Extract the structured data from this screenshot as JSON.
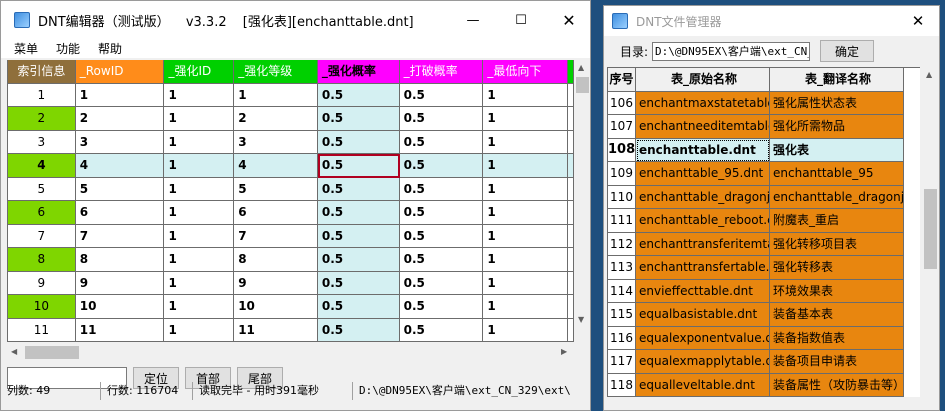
{
  "editor": {
    "app_name": "DNT编辑器（测试版）",
    "version": "v3.3.2",
    "file": "[强化表][enchanttable.dnt]",
    "menu": [
      "菜单",
      "功能",
      "帮助"
    ],
    "columns": [
      "索引信息",
      "_RowID",
      "_强化ID",
      "_强化等级",
      "_强化概率",
      "_打破概率",
      "_最低向下"
    ],
    "rows": [
      [
        "1",
        "1",
        "1",
        "1",
        "0.5",
        "0.5",
        "1"
      ],
      [
        "2",
        "2",
        "1",
        "2",
        "0.5",
        "0.5",
        "1"
      ],
      [
        "3",
        "3",
        "1",
        "3",
        "0.5",
        "0.5",
        "1"
      ],
      [
        "4",
        "4",
        "1",
        "4",
        "0.5",
        "0.5",
        "1"
      ],
      [
        "5",
        "5",
        "1",
        "5",
        "0.5",
        "0.5",
        "1"
      ],
      [
        "6",
        "6",
        "1",
        "6",
        "0.5",
        "0.5",
        "1"
      ],
      [
        "7",
        "7",
        "1",
        "7",
        "0.5",
        "0.5",
        "1"
      ],
      [
        "8",
        "8",
        "1",
        "8",
        "0.5",
        "0.5",
        "1"
      ],
      [
        "9",
        "9",
        "1",
        "9",
        "0.5",
        "0.5",
        "1"
      ],
      [
        "10",
        "10",
        "1",
        "10",
        "0.5",
        "0.5",
        "1"
      ],
      [
        "11",
        "11",
        "1",
        "11",
        "0.5",
        "0.5",
        "1"
      ]
    ],
    "selected_row": 3,
    "buttons": {
      "locate": "定位",
      "first": "首部",
      "last": "尾部"
    },
    "status": {
      "columns": "列数: 49",
      "rows": "行数: 116704",
      "load": "读取完毕 - 用时391毫秒",
      "path": "D:\\@DN95EX\\客户端\\ext_CN_329\\ext\\"
    }
  },
  "manager": {
    "title": "DNT文件管理器",
    "dir_label": "目录:",
    "dir_value": "D:\\@DN95EX\\客户端\\ext_CN_3",
    "confirm": "确定",
    "columns": [
      "序号",
      "表_原始名称",
      "表_翻译名称"
    ],
    "rows": [
      [
        "106",
        "enchantmaxstatetable.",
        "强化属性状态表"
      ],
      [
        "107",
        "enchantneeditemtable",
        "强化所需物品"
      ],
      [
        "108",
        "enchanttable.dnt",
        "强化表"
      ],
      [
        "109",
        "enchanttable_95.dnt",
        "enchanttable_95"
      ],
      [
        "110",
        "enchanttable_dragonje",
        "enchanttable_dragonje"
      ],
      [
        "111",
        "enchanttable_reboot.c",
        "附魔表_重启"
      ],
      [
        "112",
        "enchanttransferitemtal",
        "强化转移项目表"
      ],
      [
        "113",
        "enchanttransfertable.c",
        "强化转移表"
      ],
      [
        "114",
        "envieffecttable.dnt",
        "环境效果表"
      ],
      [
        "115",
        "equalbasistable.dnt",
        "装备基本表"
      ],
      [
        "116",
        "equalexponentvalue.d",
        "装备指数值表"
      ],
      [
        "117",
        "equalexmapplytable.d",
        "装备项目申请表"
      ],
      [
        "118",
        "equalleveltable.dnt",
        "装备属性（攻防暴击等）"
      ]
    ],
    "selected_row": 2
  }
}
